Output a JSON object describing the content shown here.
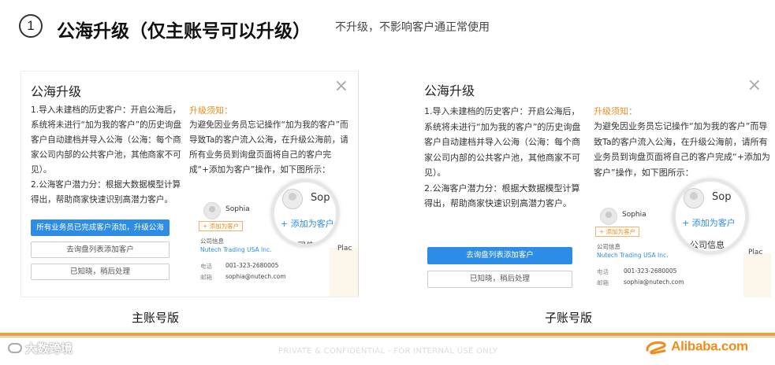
{
  "header": {
    "number": "1",
    "title": "公海升级（仅主账号可以升级）",
    "subtitle": "不升级，不影响客户通正常使用"
  },
  "left_panel": {
    "title": "公海升级",
    "close": "×",
    "body_p1": "1.导入未建档的历史客户：开启公海后，系统将未进行“加为我的客户”的历史询盘客户自动建档并导入公海（公海：每个商家公司内部的公共客户池，其他商家不可见）。",
    "body_p2": "2.公海客户潜力分：根据大数据模型计算得出，帮助商家快速识别高潜力客户。",
    "notice_title": "升级须知：",
    "notice_text": "为避免因业务员忘记操作“加为我的客户”而导致Ta的客户流入公海，在升级公海前，请所有业务员到询盘页面将自己的客户完成“+添加为客户”操作，如下图所示：",
    "buttons": [
      "所有业务员已完成客户添加，升级公海",
      "去询盘列表添加客户",
      "已知晓，稍后处理"
    ]
  },
  "right_panel": {
    "title": "公海升级",
    "close": "×",
    "body_p1": "1.导入未建档的历史客户：开启公海后，系统将未进行“加为我的客户”的历史询盘客户自动建档并导入公海（公海：每个商家公司内部的公共客户池，其他商家不可见）。",
    "body_p2": "2.公海客户潜力分：根据大数据模型计算得出，帮助商家快速识别高潜力客户。",
    "notice_title": "升级须知：",
    "notice_text": "为避免因业务员忘记操作“加为我的客户”而导致Ta的客户流入公海，在升级公海前，请所有业务员到询盘页面将自己的客户完成“+添加为客户”操作，如下图所示：",
    "buttons": [
      "去询盘列表添加客户",
      "已知晓，稍后处理"
    ]
  },
  "mock_card": {
    "name": "Sophia",
    "add_label": "+ 添加为客户",
    "company_label": "公司信息",
    "company": "Nutech Trading USA Inc.",
    "phone_key": "电话",
    "phone": "001-323-2680005",
    "email_key": "邮箱",
    "email": "sophia@nutech.com",
    "mag_name": "Sop",
    "mag_name_right": "Sop",
    "mag_add": "+ 添加为客户",
    "mag_company": "公司信息",
    "side": "Plac"
  },
  "labels": {
    "main": "主账号版",
    "sub": "子账号版"
  },
  "footer": {
    "confidential": "PRIVATE & CONFIDENTIAL - FOR INTERNAL USE ONLY",
    "watermark": "大数跨境",
    "logo": "Alibaba.com"
  },
  "colors": {
    "primary": "#2d8ce5",
    "accent": "#f08c1a"
  }
}
